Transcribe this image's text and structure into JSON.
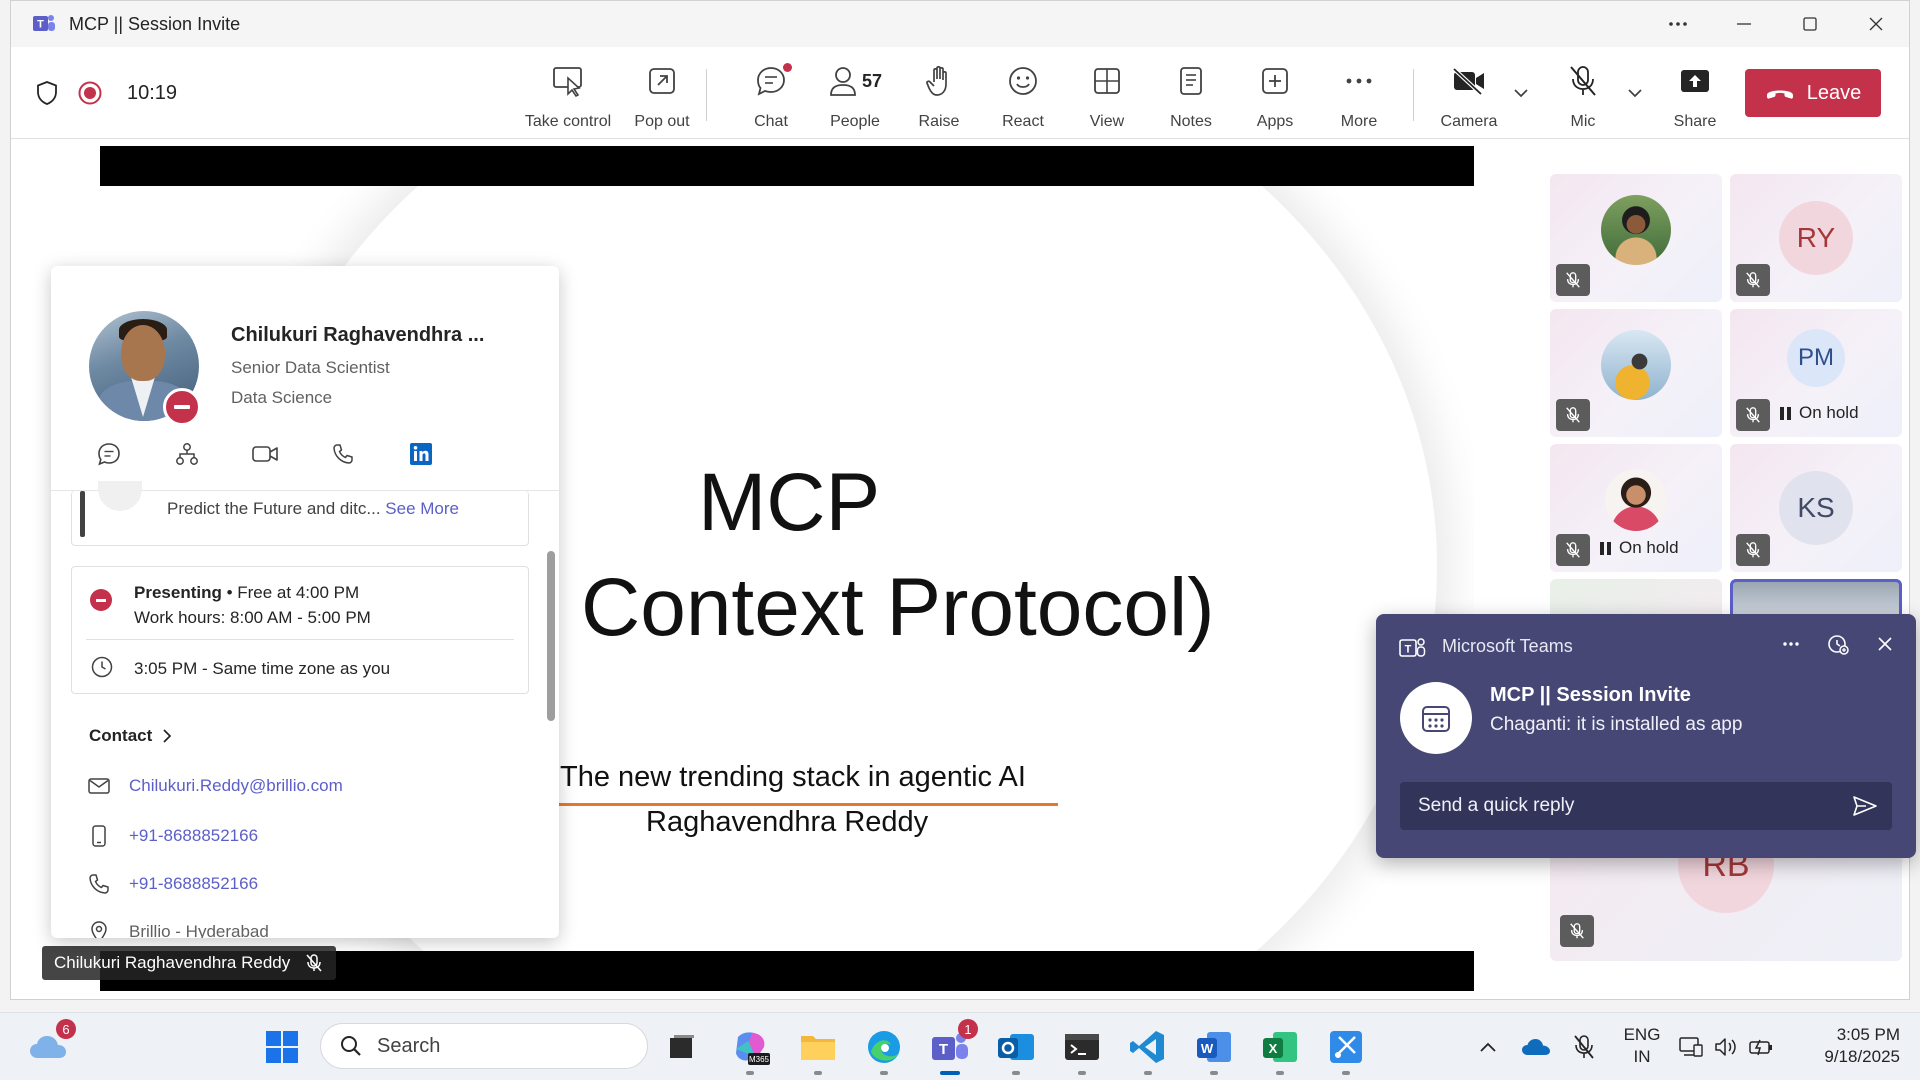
{
  "window": {
    "title": "MCP || Session Invite"
  },
  "meeting": {
    "elapsed": "10:19",
    "toolbar": {
      "take_control": "Take control",
      "pop_out": "Pop out",
      "chat": "Chat",
      "people": "People",
      "people_count": "57",
      "raise": "Raise",
      "react": "React",
      "view": "View",
      "notes": "Notes",
      "apps": "Apps",
      "more": "More",
      "camera": "Camera",
      "mic": "Mic",
      "share": "Share",
      "leave": "Leave"
    }
  },
  "slide": {
    "title_line1": "MCP",
    "title_line2": "l Context Protocol)",
    "subtitle": "The new trending stack in agentic AI",
    "author": "Raghavendhra Reddy"
  },
  "presenter_tag": "Chilukuri Raghavendhra Reddy",
  "profile_card": {
    "name": "Chilukuri Raghavendhra ...",
    "role": "Senior Data Scientist",
    "department": "Data Science",
    "note": "Predict the Future and ditc...",
    "see_more": "See More",
    "presence_status": "Presenting",
    "presence_free": " • Free at 4:00 PM",
    "work_hours": "Work hours: 8:00 AM - 5:00 PM",
    "local_time": "3:05 PM - Same time zone as you",
    "contact_heading": "Contact",
    "email": "Chilukuri.Reddy@brillio.com",
    "mobile": "+91-8688852166",
    "phone": "+91-8688852166",
    "location": "Brillio - Hyderabad"
  },
  "participants": {
    "ry": "RY",
    "pm": "PM",
    "ks": "KS",
    "rb": "RB",
    "on_hold": "On hold"
  },
  "toast": {
    "app": "Microsoft Teams",
    "title": "MCP || Session Invite",
    "body": "Chaganti: it is installed as app",
    "reply_placeholder": "Send a quick reply"
  },
  "taskbar": {
    "weather_badge": "6",
    "search": "Search",
    "teams_badge": "1",
    "lang_line1": "ENG",
    "lang_line2": "IN",
    "time": "3:05 PM",
    "date": "9/18/2025"
  },
  "colors": {
    "brand": "#5b5fc7",
    "leave": "#c4314b",
    "toast_bg": "#464775"
  }
}
